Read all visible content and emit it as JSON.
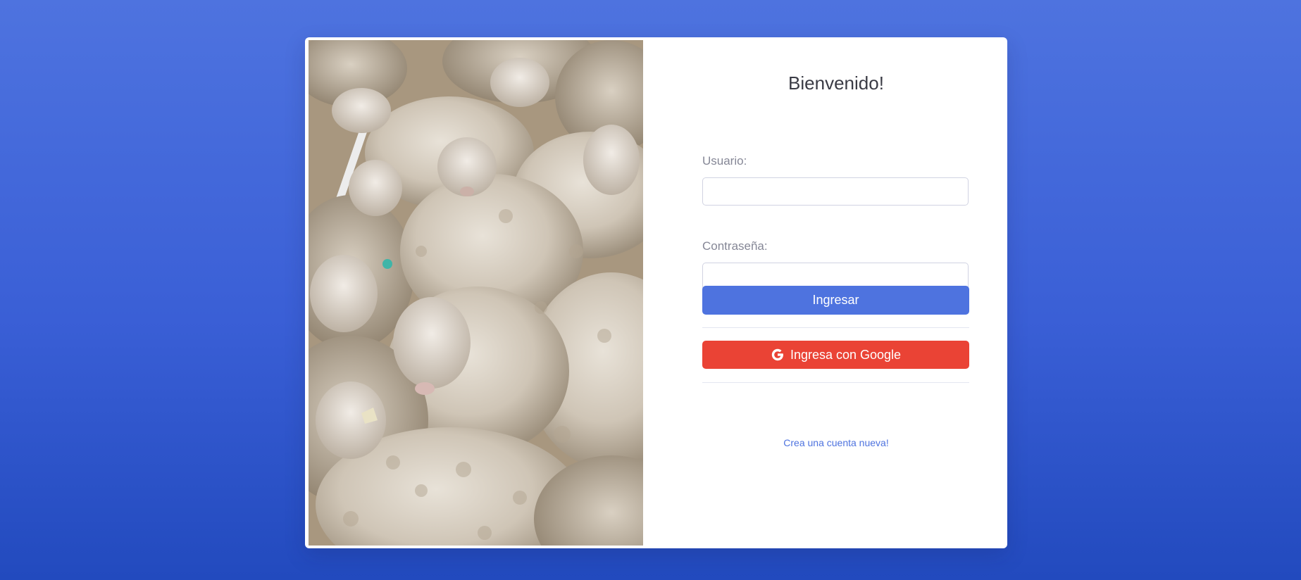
{
  "login": {
    "title": "Bienvenido!",
    "username_label": "Usuario:",
    "username_value": "",
    "password_label": "Contraseña:",
    "password_value": "",
    "submit_label": "Ingresar",
    "google_label": "Ingresa con Google",
    "register_link": "Crea una cuenta nueva!"
  },
  "image": {
    "subject": "flock of merino sheep photo"
  },
  "icons": {
    "google": "google-icon"
  },
  "colors": {
    "background_top": "#4e73df",
    "background_bottom": "#224abe",
    "primary": "#4e73df",
    "google": "#ea4335",
    "label_text": "#858796",
    "title_text": "#3a3b45"
  }
}
